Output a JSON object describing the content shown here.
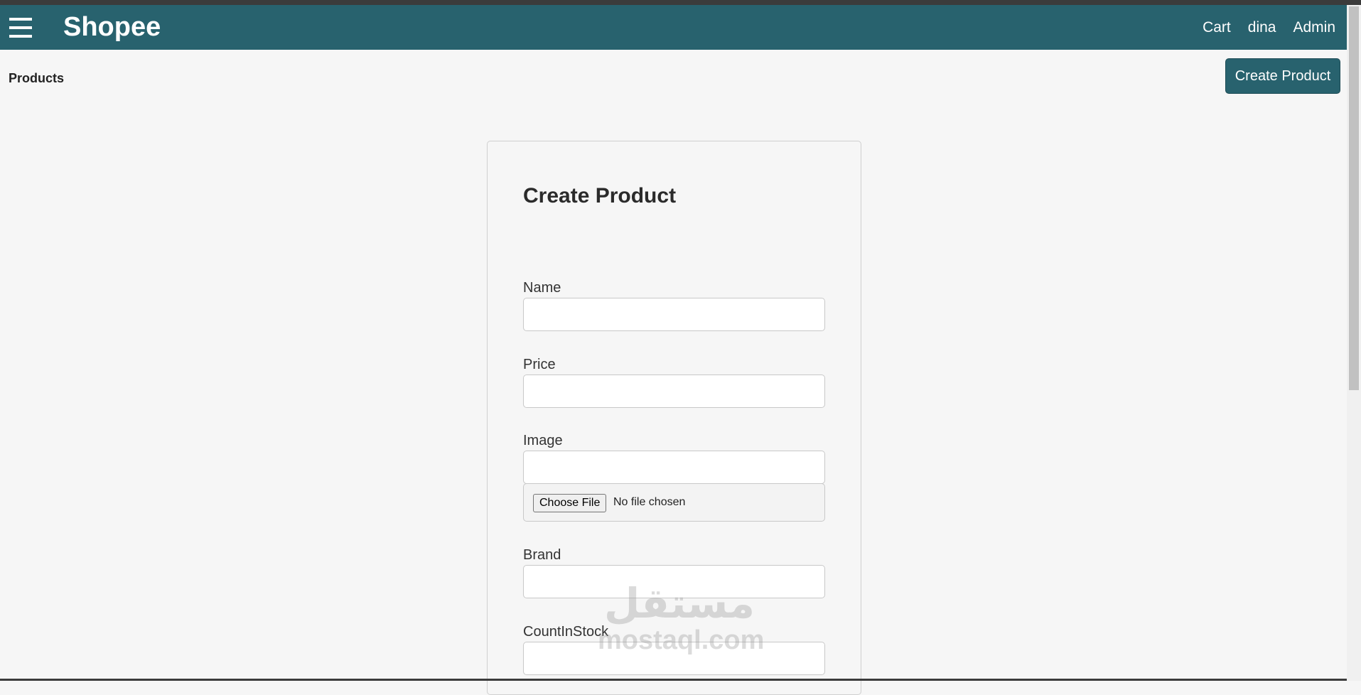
{
  "header": {
    "brand": "Shopee",
    "nav": [
      "Cart",
      "dina",
      "Admin"
    ]
  },
  "breadcrumb": "Products",
  "top_button": "Create Product",
  "form": {
    "title": "Create Product",
    "fields": {
      "name": {
        "label": "Name",
        "value": ""
      },
      "price": {
        "label": "Price",
        "value": ""
      },
      "image": {
        "label": "Image",
        "value": ""
      },
      "brand": {
        "label": "Brand",
        "value": ""
      },
      "count": {
        "label": "CountInStock",
        "value": ""
      }
    },
    "file": {
      "button": "Choose File",
      "status": "No file chosen"
    }
  },
  "watermark": {
    "logo": "مستقل",
    "text": "mostaql.com"
  },
  "colors": {
    "header": "#28626e",
    "background": "#f6f6f6"
  }
}
